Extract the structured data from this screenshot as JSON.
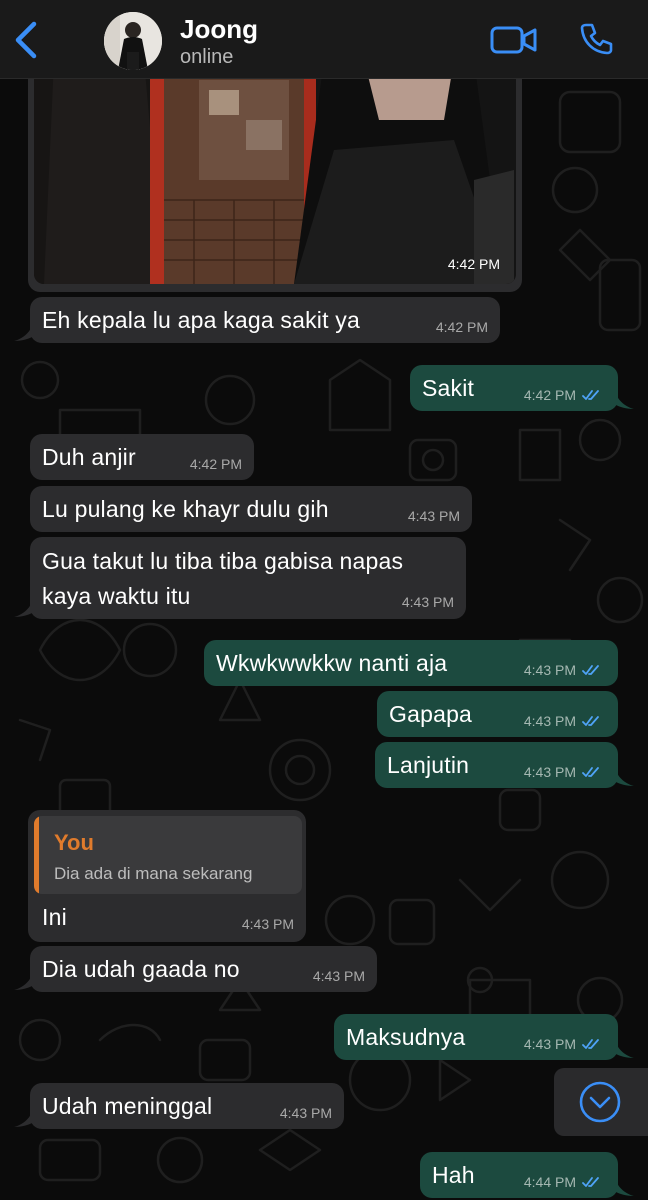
{
  "header": {
    "contact_name": "Joong",
    "status": "online"
  },
  "colors": {
    "accent": "#3a8ef6",
    "incoming_bubble": "#2c2c2e",
    "outgoing_bubble": "#1c4a3f",
    "quote_accent": "#e07b2c",
    "read_ticks": "#4fa3f7"
  },
  "icons": [
    "back-chevron-icon",
    "video-camera-icon",
    "phone-icon",
    "double-check-icon",
    "chevron-down-icon"
  ],
  "image_message": {
    "time": "4:42 PM"
  },
  "messages": [
    {
      "direction": "in",
      "text": "Eh kepala lu apa kaga sakit ya",
      "time": "4:42 PM"
    },
    {
      "direction": "out",
      "text": "Sakit",
      "time": "4:42 PM"
    },
    {
      "direction": "in",
      "text": "Duh anjir",
      "time": "4:42 PM"
    },
    {
      "direction": "in",
      "text": "Lu pulang ke khayr dulu gih",
      "time": "4:43 PM"
    },
    {
      "direction": "in",
      "lines": [
        "Gua takut lu tiba tiba gabisa napas",
        "kaya waktu itu"
      ],
      "time": "4:43 PM"
    },
    {
      "direction": "out",
      "text": "Wkwkwwkkw nanti aja",
      "time": "4:43 PM"
    },
    {
      "direction": "out",
      "text": "Gapapa",
      "time": "4:43 PM"
    },
    {
      "direction": "out",
      "text": "Lanjutin",
      "time": "4:43 PM"
    },
    {
      "direction": "in",
      "text": "Ini",
      "time": "4:43 PM",
      "quote": {
        "author": "You",
        "text": "Dia ada di mana sekarang"
      }
    },
    {
      "direction": "in",
      "text": "Dia udah gaada no",
      "time": "4:43 PM"
    },
    {
      "direction": "out",
      "text": "Maksudnya",
      "time": "4:43 PM"
    },
    {
      "direction": "in",
      "text": "Udah meninggal",
      "time": "4:43 PM"
    },
    {
      "direction": "out",
      "text": "Hah",
      "time": "4:44 PM"
    }
  ]
}
